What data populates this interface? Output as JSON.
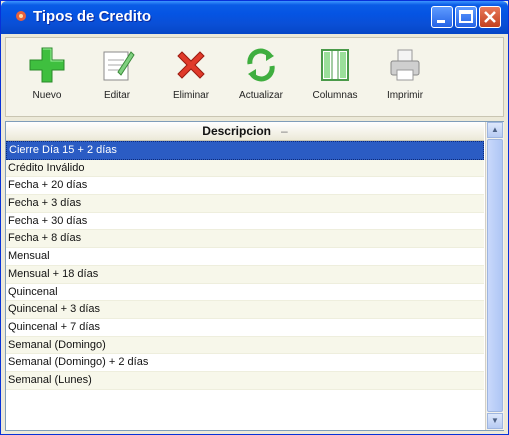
{
  "window": {
    "title": "Tipos de Credito",
    "icon": "app-icon"
  },
  "toolbar": {
    "buttons": [
      {
        "id": "nuevo",
        "label": "Nuevo",
        "icon": "plus-icon"
      },
      {
        "id": "editar",
        "label": "Editar",
        "icon": "edit-icon"
      },
      {
        "id": "eliminar",
        "label": "Eliminar",
        "icon": "delete-icon"
      },
      {
        "id": "actualizar",
        "label": "Actualizar",
        "icon": "refresh-icon"
      },
      {
        "id": "columnas",
        "label": "Columnas",
        "icon": "columns-icon"
      },
      {
        "id": "imprimir",
        "label": "Imprimir",
        "icon": "printer-icon"
      }
    ]
  },
  "grid": {
    "header": "Descripcion",
    "sort_indicator": "–",
    "rows": [
      "Cierre Día 15 + 2 días",
      "Crédito Inválido",
      "Fecha + 20 días",
      "Fecha + 3 días",
      "Fecha + 30 días",
      "Fecha + 8 días",
      "Mensual",
      "Mensual + 18 días",
      "Quincenal",
      "Quincenal + 3 días",
      "Quincenal + 7 días",
      "Semanal (Domingo)",
      "Semanal (Domingo) + 2 días",
      "Semanal (Lunes)"
    ],
    "selected_index": 0
  },
  "colors": {
    "title_bar": "#0554e3",
    "selection": "#2b5cc4",
    "plus": "#3fbf3f",
    "delete": "#e03a2a"
  }
}
